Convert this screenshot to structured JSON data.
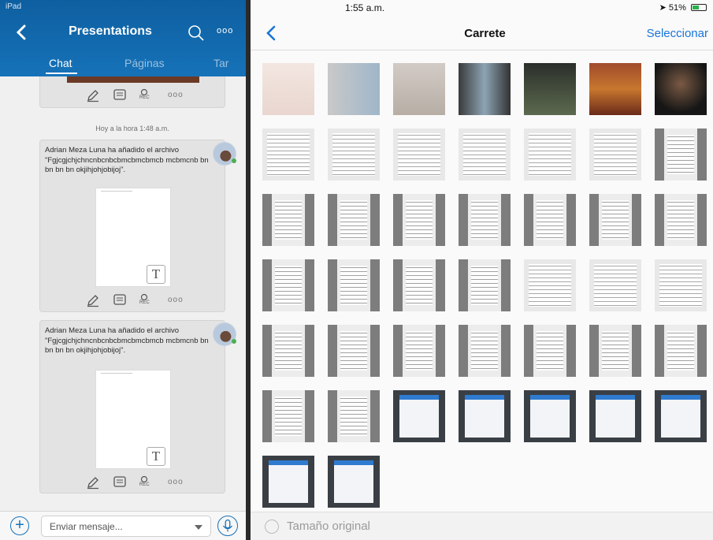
{
  "chat_pane": {
    "status": "iPad",
    "title": "Presentations",
    "more": "ooo",
    "tabs": {
      "chat": "Chat",
      "pages": "Páginas",
      "tasks": "Tar"
    },
    "date_separator": "Hoy a la hora 1:48 a.m.",
    "actions": {
      "rec": "REC",
      "more": "ooo"
    },
    "messages": [
      {
        "text": "Adrian Meza Luna ha añadido el archivo \"Fgjcgjchjchncnbcnbcbmcbmcbmcb mcbmcnb bn bn bn bn okjihjohjobijoj\".",
        "attachment_icon": "T"
      },
      {
        "text": "Adrian Meza Luna ha añadido el archivo \"Fgjcgjchjchncnbcnbcbmcbmcbmcb mcbmcnb bn bn bn bn okjihjohjobijoj\".",
        "attachment_icon": "T"
      }
    ],
    "composer": {
      "add": "+",
      "placeholder": "Enviar mensaje..."
    }
  },
  "camera_roll": {
    "status_time": "1:55 a.m.",
    "battery": "51%",
    "title": "Carrete",
    "select_label": "Seleccionar",
    "original_size_label": "Tamaño original"
  },
  "colors": {
    "header_blue": "#1672b8",
    "ios_blue": "#1a74d8",
    "battery_green": "#26b34a"
  },
  "icons": [
    "back-arrow",
    "search",
    "pencil",
    "comment",
    "rec-mic",
    "more",
    "plus",
    "microphone",
    "location-arrow",
    "battery"
  ]
}
